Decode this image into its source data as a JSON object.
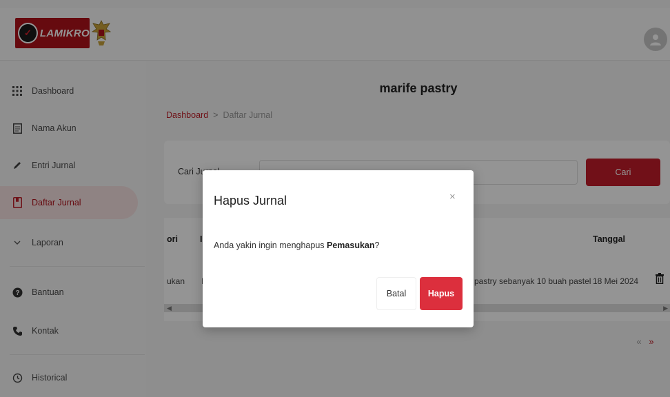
{
  "brand": {
    "logo_text": "LAMIKRO",
    "logo_color": "#b0121b"
  },
  "sidebar": {
    "items": [
      {
        "label": "Dashboard",
        "icon": "grid-icon"
      },
      {
        "label": "Nama Akun",
        "icon": "document-icon"
      },
      {
        "label": "Entri Jurnal",
        "icon": "pencil-icon"
      },
      {
        "label": "Daftar Jurnal",
        "icon": "journal-icon",
        "active": true
      },
      {
        "label": "Laporan",
        "icon": "chevron-down-icon"
      },
      {
        "label": "Bantuan",
        "icon": "help-icon"
      },
      {
        "label": "Kontak",
        "icon": "phone-icon"
      },
      {
        "label": "Historical",
        "icon": "history-icon"
      }
    ]
  },
  "main": {
    "title": "marife pastry",
    "breadcrumb": {
      "home": "Dashboard",
      "separator": ">",
      "current": "Daftar Jurnal"
    },
    "search": {
      "label": "Cari Jurnal",
      "placeholder": "",
      "button_label": "Cari"
    },
    "table": {
      "headers": {
        "kategori": "ori",
        "col2": "I",
        "tanggal": "Tanggal"
      },
      "rows": [
        {
          "kategori": "ukan",
          "col2": "I",
          "keterangan": "pastry sebanyak 10 buah pastel",
          "tanggal": "18 Mei 2024"
        }
      ]
    },
    "pager": {
      "prev": "«",
      "next": "»"
    }
  },
  "modal": {
    "title": "Hapus Jurnal",
    "close_label": "×",
    "message_prefix": "Anda yakin ingin menghapus ",
    "message_item": "Pemasukan",
    "message_suffix": "?",
    "cancel_label": "Batal",
    "delete_label": "Hapus"
  },
  "colors": {
    "accent": "#c31c2a",
    "danger": "#dc2f3d",
    "active_bg": "#f6e2e2"
  }
}
